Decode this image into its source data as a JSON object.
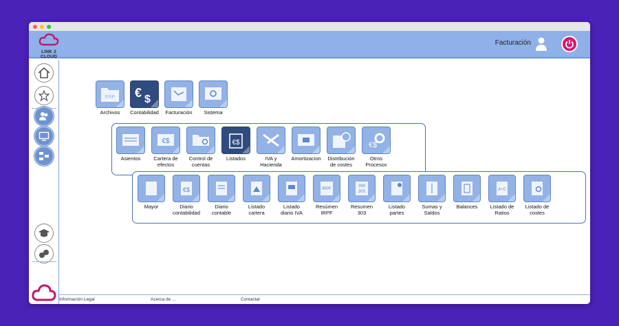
{
  "window": {
    "dots": [
      "#ff5f57",
      "#febc2e",
      "#28c840"
    ]
  },
  "header": {
    "logo_text": "LINK 2 CLOUD",
    "logo_sub": "",
    "section_label": "Facturación"
  },
  "sidebar": {
    "items": [
      {
        "name": "home"
      },
      {
        "name": "favorites"
      },
      {
        "name": "users"
      },
      {
        "name": "monitor"
      },
      {
        "name": "network"
      },
      {
        "name": "education"
      },
      {
        "name": "handshake"
      }
    ]
  },
  "modules": [
    {
      "label": "Archivos",
      "icon": "erp"
    },
    {
      "label": "Contabilidad",
      "icon": "euro-dollar",
      "active": true
    },
    {
      "label": "Facturación",
      "icon": "invoice"
    },
    {
      "label": "Sistema",
      "icon": "gear"
    }
  ],
  "contabilidad": [
    {
      "label": "Asientos"
    },
    {
      "label": "Cartera de\nefectos"
    },
    {
      "label": "Control de\ncuentas"
    },
    {
      "label": "Listados",
      "active": true
    },
    {
      "label": "IVA y\nHacienda"
    },
    {
      "label": "Amortizacion"
    },
    {
      "label": "Distribución\nde costes"
    },
    {
      "label": "Otros\nProcesos"
    }
  ],
  "listados": [
    {
      "label": "Mayor"
    },
    {
      "label": "Diario\ncontabilidad"
    },
    {
      "label": "Diario\ncontable"
    },
    {
      "label": "Listado\ncartera"
    },
    {
      "label": "Listado\ndiario IVA"
    },
    {
      "label": "Resúmen\nIRPF"
    },
    {
      "label": "Resumen\n303"
    },
    {
      "label": "Listado\npartes"
    },
    {
      "label": "Sumas y\nSaldos"
    },
    {
      "label": "Balances"
    },
    {
      "label": "Listado de\nRatios"
    },
    {
      "label": "Listado de\ncostes"
    }
  ],
  "footer": {
    "legal": "Información Legal",
    "about": "Acerca de ...",
    "contact": "Contactar"
  },
  "colors": {
    "accent": "#d6186c",
    "header": "#8fb0e8",
    "tile": "#93b2e6",
    "tile_active": "#2f4b7f"
  }
}
